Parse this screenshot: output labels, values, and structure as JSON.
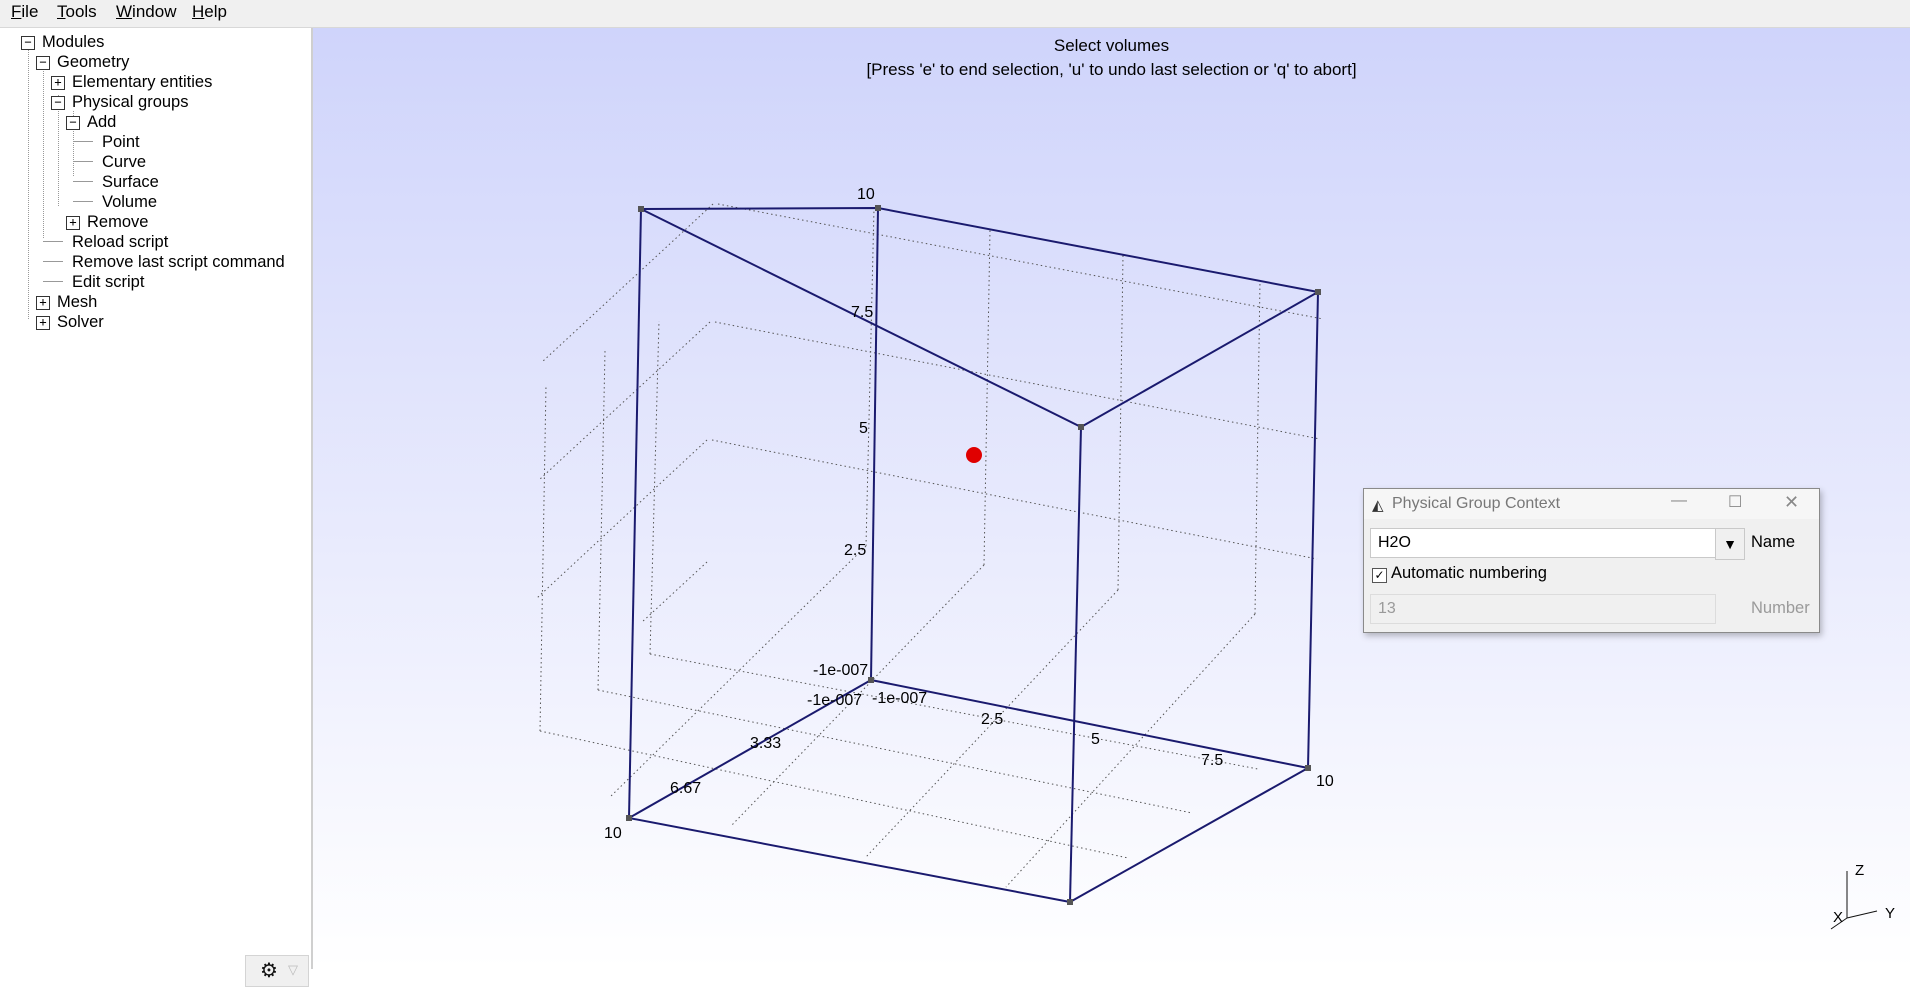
{
  "menubar": {
    "items": [
      {
        "label": "File",
        "mnemonic": "F"
      },
      {
        "label": "Tools",
        "mnemonic": "T"
      },
      {
        "label": "Window",
        "mnemonic": "W"
      },
      {
        "label": "Help",
        "mnemonic": "H"
      }
    ]
  },
  "tree": {
    "modules": "Modules",
    "geometry": "Geometry",
    "elementary_entities": "Elementary entities",
    "physical_groups": "Physical groups",
    "add": "Add",
    "point": "Point",
    "curve": "Curve",
    "surface": "Surface",
    "volume": "Volume",
    "remove": "Remove",
    "reload_script": "Reload script",
    "remove_last_script_command": "Remove last script command",
    "edit_script": "Edit script",
    "mesh": "Mesh",
    "solver": "Solver"
  },
  "viewport": {
    "status_title": "Select volumes",
    "status_hint": "[Press 'e' to end selection, 'u' to undo last selection or 'q' to abort]",
    "box_edge_color": "#1a1a6e",
    "selection_color": "#e00000",
    "axis_labels": {
      "z_top": "10",
      "z_75": "7.5",
      "z_5": "5",
      "z_25": "2.5",
      "z_origin": "-1e-007",
      "x_origin": "-1e-007",
      "y_origin": "-1e-007",
      "x_333": "3.33",
      "x_667": "6.67",
      "x_10": "10",
      "y_25": "2.5",
      "y_5": "5",
      "y_75": "7.5",
      "y_10": "10"
    },
    "triad": {
      "z": "Z",
      "y": "Y",
      "x": "X"
    }
  },
  "dialog": {
    "title": "Physical Group Context",
    "name_value": "H2O",
    "name_label": "Name",
    "auto_numbering_label": "Automatic numbering",
    "auto_numbering_checked": true,
    "number_value": "13",
    "number_label": "Number"
  }
}
